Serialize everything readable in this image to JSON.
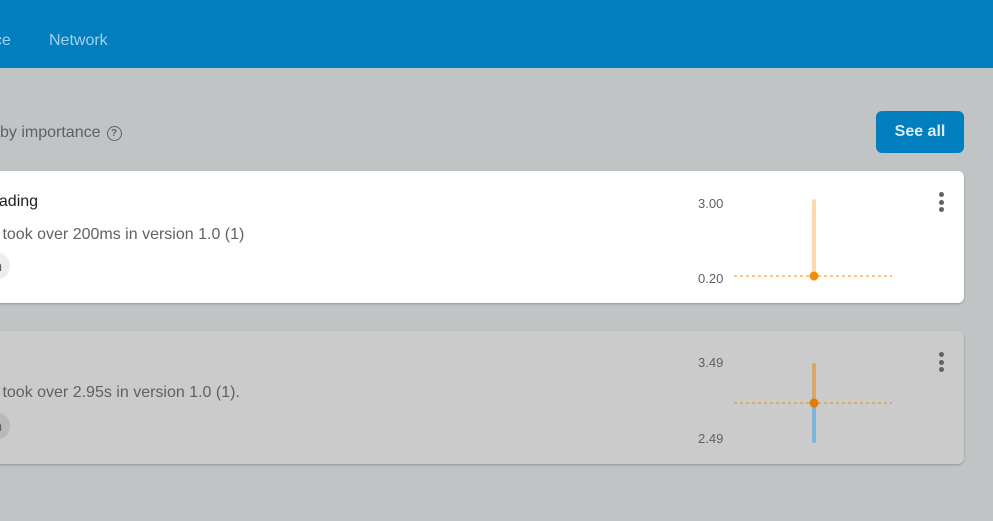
{
  "topbar": {
    "tabs": [
      {
        "label": "ce"
      },
      {
        "label": "Network"
      }
    ]
  },
  "section": {
    "title": "by importance",
    "see_all_label": "See all"
  },
  "issues": [
    {
      "title": "oading",
      "description": "s took over 200ms in version 1.0 (1)",
      "chip": "n",
      "chart": {
        "y_max_label": "3.00",
        "y_min_label": "0.20",
        "y_max": 3.0,
        "y_min": 0.2,
        "threshold": 0.2,
        "point": 0.2,
        "range_high": 3.0,
        "range_low": 0.1,
        "colors": {
          "upper": "#fcd9ac",
          "lower": "#a8d4ee",
          "point": "#f48c06",
          "threshold": "#f48c06"
        }
      }
    },
    {
      "title": "",
      "description": "s took over 2.95s in version 1.0 (1).",
      "chip": "n",
      "chart": {
        "y_max_label": "3.49",
        "y_min_label": "2.49",
        "y_max": 3.49,
        "y_min": 2.49,
        "threshold": 2.95,
        "point": 2.95,
        "range_high": 3.45,
        "range_low": 2.45,
        "colors": {
          "upper": "#dba66a",
          "lower": "#7db5d8",
          "point": "#e17b06",
          "threshold": "#e68a12"
        }
      }
    }
  ]
}
